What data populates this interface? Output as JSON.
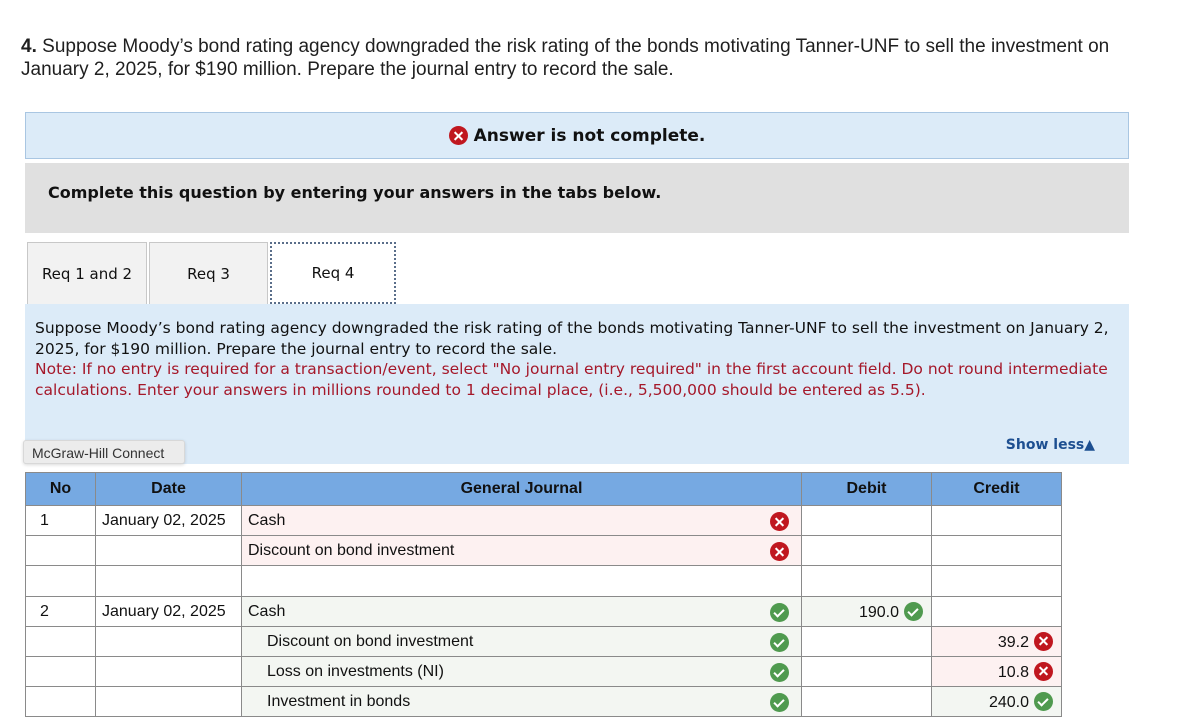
{
  "question": {
    "number": "4.",
    "line1": "Suppose Moody’s bond rating agency downgraded the risk rating of the bonds motivating Tanner-UNF to sell the investment on",
    "line2": "January 2, 2025, for $190 million. Prepare the journal entry to record the sale."
  },
  "status_banner": {
    "icon": "x-circle-icon",
    "text": "Answer is not complete.",
    "color": "#c0171f"
  },
  "instruction": "Complete this question by entering your answers in the tabs below.",
  "tabs": [
    {
      "label": "Req 1 and 2",
      "active": false
    },
    {
      "label": "Req 3",
      "active": false
    },
    {
      "label": "Req 4",
      "active": true
    }
  ],
  "panel": {
    "prompt": "Suppose Moody’s bond rating agency downgraded the risk rating of the bonds motivating Tanner-UNF to sell the investment on January 2, 2025, for $190 million. Prepare the journal entry to record the sale.",
    "note": "Note: If no entry is required for a transaction/event, select \"No journal entry required\" in the first account field. Do not round intermediate calculations. Enter your answers in millions rounded to 1 decimal place, (i.e., 5,500,000 should be entered as 5.5).",
    "show_less": "Show less▲"
  },
  "tooltip": "McGraw-Hill Connect",
  "journal": {
    "headers": {
      "no": "No",
      "date": "Date",
      "account": "General Journal",
      "debit": "Debit",
      "credit": "Credit"
    },
    "rows": [
      {
        "no": "1",
        "date": "January 02, 2025",
        "account": "Cash",
        "indent": false,
        "account_status": "wrong",
        "debit": "",
        "debit_status": "",
        "credit": "",
        "credit_status": ""
      },
      {
        "no": "",
        "date": "",
        "account": "Discount on bond investment",
        "indent": false,
        "account_status": "wrong",
        "debit": "",
        "debit_status": "",
        "credit": "",
        "credit_status": ""
      },
      {
        "no": "",
        "date": "",
        "account": "",
        "indent": false,
        "account_status": "",
        "debit": "",
        "debit_status": "",
        "credit": "",
        "credit_status": ""
      },
      {
        "no": "2",
        "date": "January 02, 2025",
        "account": "Cash",
        "indent": false,
        "account_status": "right",
        "debit": "190.0",
        "debit_status": "right",
        "credit": "",
        "credit_status": ""
      },
      {
        "no": "",
        "date": "",
        "account": "Discount on bond investment",
        "indent": true,
        "account_status": "right",
        "debit": "",
        "debit_status": "",
        "credit": "39.2",
        "credit_status": "wrong"
      },
      {
        "no": "",
        "date": "",
        "account": "Loss on investments (NI)",
        "indent": true,
        "account_status": "right",
        "debit": "",
        "debit_status": "",
        "credit": "10.8",
        "credit_status": "wrong"
      },
      {
        "no": "",
        "date": "",
        "account": "Investment in bonds",
        "indent": true,
        "account_status": "right",
        "debit": "",
        "debit_status": "",
        "credit": "240.0",
        "credit_status": "right"
      }
    ]
  },
  "colors": {
    "header_blue": "#76a9e2",
    "panel_blue": "#dcebf8",
    "note_red": "#a5182a",
    "wrong_red": "#c0171f",
    "right_green": "#4f9a4f",
    "link_blue": "#1d4f91"
  }
}
